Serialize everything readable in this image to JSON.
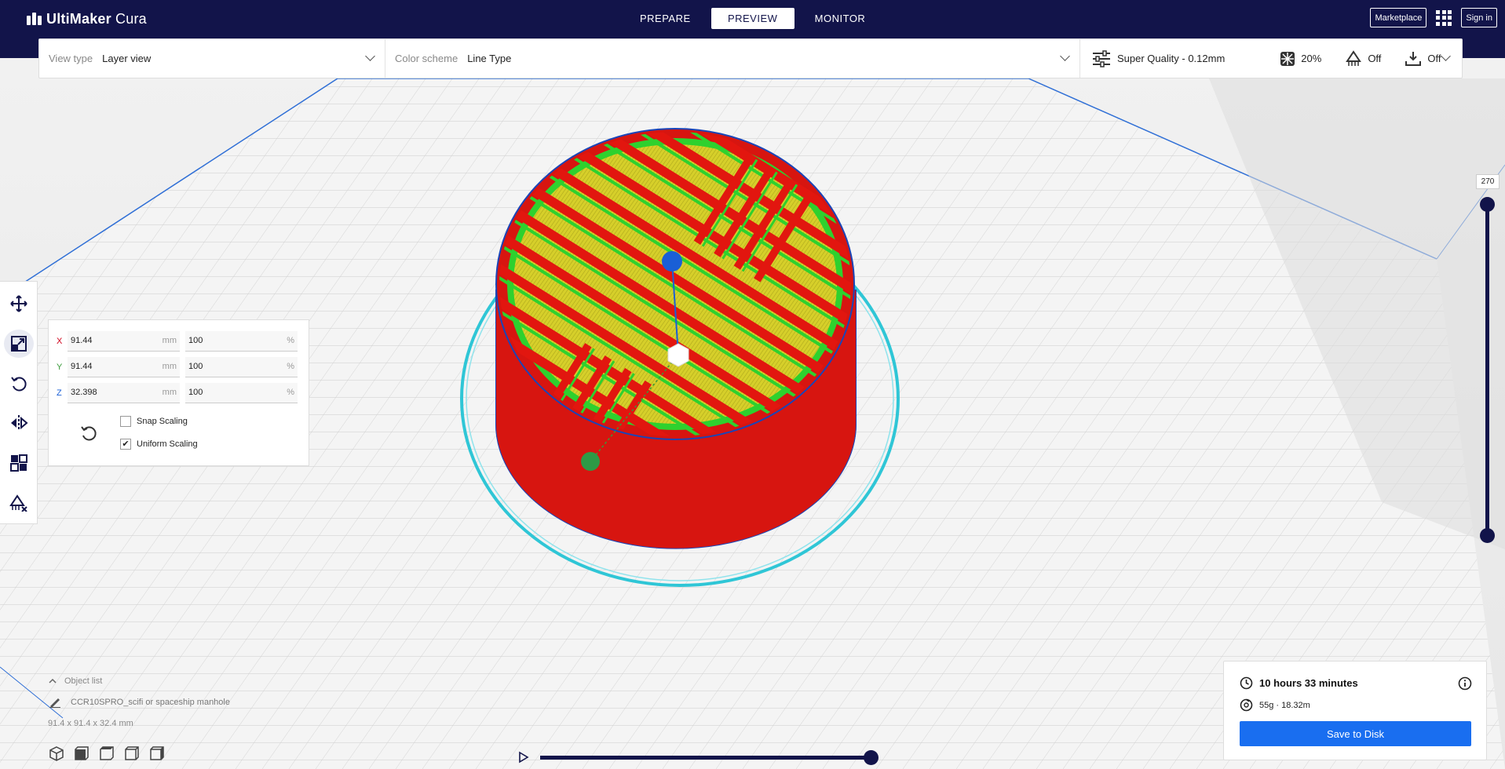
{
  "app": {
    "brand_prefix": "UltiMaker",
    "brand_suffix": "Cura",
    "tabs": [
      {
        "label": "PREPARE",
        "active": false
      },
      {
        "label": "PREVIEW",
        "active": true
      },
      {
        "label": "MONITOR",
        "active": false
      }
    ],
    "marketplace_label": "Marketplace",
    "signin_label": "Sign in",
    "header_color": "#12144a"
  },
  "toolbar": {
    "view_type_label": "View type",
    "view_type_value": "Layer view",
    "color_scheme_label": "Color scheme",
    "color_scheme_value": "Line Type",
    "quality": "Super Quality - 0.12mm",
    "infill": "20%",
    "support": "Off",
    "adhesion": "Off"
  },
  "left_tools": [
    {
      "name": "move-tool",
      "icon": "move-icon",
      "active": false
    },
    {
      "name": "scale-tool",
      "icon": "scale-icon",
      "active": true
    },
    {
      "name": "rotate-tool",
      "icon": "rotate-icon",
      "active": false
    },
    {
      "name": "mirror-tool",
      "icon": "mirror-icon",
      "active": false
    },
    {
      "name": "per-model-settings-tool",
      "icon": "per-model-settings-icon",
      "active": false
    },
    {
      "name": "support-blocker-tool",
      "icon": "support-blocker-icon",
      "active": false
    }
  ],
  "scale_panel": {
    "x": {
      "axis": "X",
      "mm": "91.44",
      "percent": "100",
      "color": "#d0021b"
    },
    "y": {
      "axis": "Y",
      "mm": "91.44",
      "percent": "100",
      "color": "#3a9a3a"
    },
    "z": {
      "axis": "Z",
      "mm": "32.398",
      "percent": "100",
      "color": "#1a5fd6"
    },
    "unit_mm": "mm",
    "unit_pct": "%",
    "snap_scaling_label": "Snap Scaling",
    "snap_scaling_checked": false,
    "uniform_scaling_label": "Uniform Scaling",
    "uniform_scaling_checked": true
  },
  "layer_slider": {
    "current_layer": "270"
  },
  "object_list": {
    "header": "Object list",
    "file_name": "CCR10SPRO_scifi or spaceship manhole",
    "dimensions": "91.4 x 91.4 x 32.4 mm"
  },
  "print_info": {
    "time": "10 hours 33 minutes",
    "material": "55g · 18.32m",
    "save_label": "Save to Disk",
    "button_color": "#196ef0"
  },
  "colors": {
    "wall": "#e2160f",
    "infill": "#e6e02a",
    "inner_wall": "#2ed12e",
    "skirt": "#2fc6d6",
    "build_plate_outline": "#2f6fd6"
  }
}
